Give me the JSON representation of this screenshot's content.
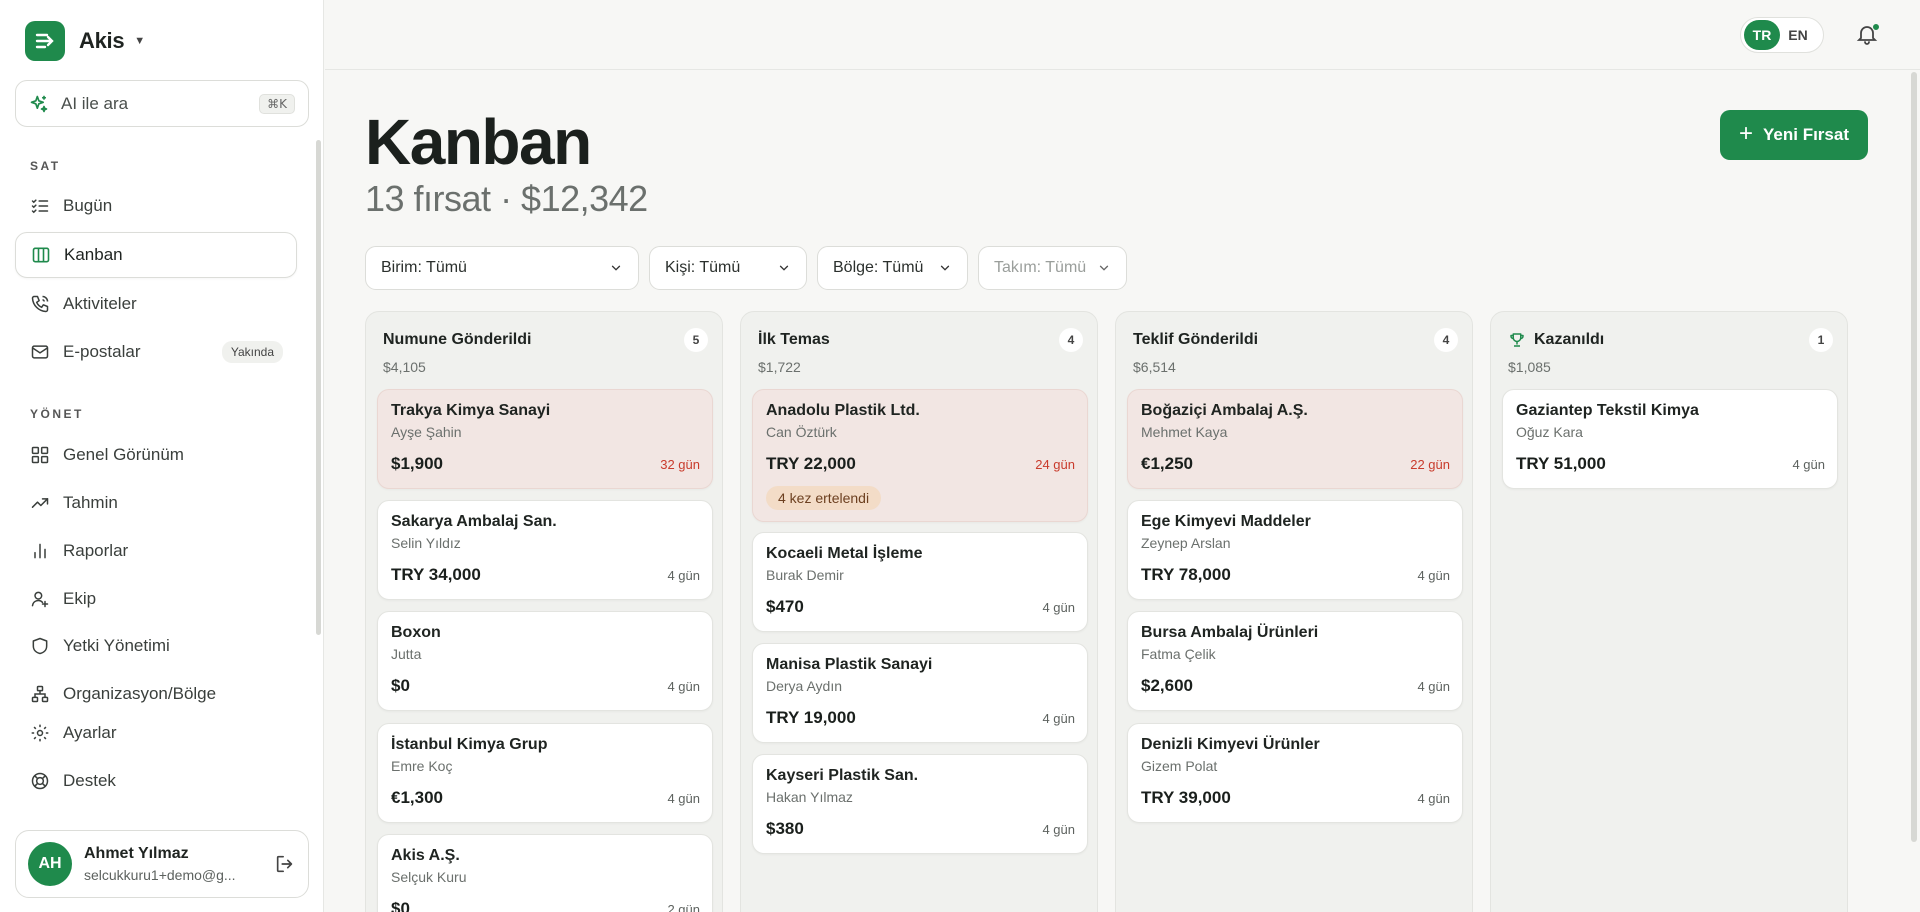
{
  "brand": {
    "name": "Akis"
  },
  "ai_search": {
    "label": "AI ile ara",
    "shortcut": "⌘K"
  },
  "sidebar": {
    "section_sell": "SAT",
    "section_manage": "YÖNET",
    "items": [
      {
        "label": "Bugün"
      },
      {
        "label": "Kanban"
      },
      {
        "label": "Aktiviteler"
      },
      {
        "label": "E-postalar",
        "badge": "Yakında"
      },
      {
        "label": "Genel Görünüm"
      },
      {
        "label": "Tahmin"
      },
      {
        "label": "Raporlar"
      },
      {
        "label": "Ekip"
      },
      {
        "label": "Yetki Yönetimi"
      },
      {
        "label": "Organizasyon/Bölge"
      },
      {
        "label": "Ayarlar"
      },
      {
        "label": "Destek"
      }
    ]
  },
  "user": {
    "initials": "AH",
    "name": "Ahmet Yılmaz",
    "email": "selcukkuru1+demo@g..."
  },
  "lang": {
    "tr": "TR",
    "en": "EN",
    "selected": "TR"
  },
  "header": {
    "title": "Kanban",
    "subtitle": "13 fırsat · $12,342",
    "new_button": "Yeni Fırsat"
  },
  "filters": [
    {
      "label": "Birim: Tümü"
    },
    {
      "label": "Kişi: Tümü"
    },
    {
      "label": "Bölge: Tümü"
    },
    {
      "label": "Takım: Tümü"
    }
  ],
  "columns": [
    {
      "title": "Numune Gönderildi",
      "count": "5",
      "total": "$4,105",
      "cards": [
        {
          "title": "Trakya Kimya Sanayi",
          "person": "Ayşe Şahin",
          "amount": "$1,900",
          "days": "32 gün"
        },
        {
          "title": "Sakarya Ambalaj San.",
          "person": "Selin Yıldız",
          "amount": "TRY 34,000",
          "days": "4 gün"
        },
        {
          "title": "Boxon",
          "person": "Jutta",
          "amount": "$0",
          "days": "4 gün"
        },
        {
          "title": "İstanbul Kimya Grup",
          "person": "Emre Koç",
          "amount": "€1,300",
          "days": "4 gün"
        },
        {
          "title": "Akis A.Ş.",
          "person": "Selçuk Kuru",
          "amount": "$0",
          "days": "2 gün"
        }
      ]
    },
    {
      "title": "İlk Temas",
      "count": "4",
      "total": "$1,722",
      "cards": [
        {
          "title": "Anadolu Plastik Ltd.",
          "person": "Can Öztürk",
          "amount": "TRY 22,000",
          "days": "24 gün",
          "postponed": "4 kez ertelendi"
        },
        {
          "title": "Kocaeli Metal İşleme",
          "person": "Burak Demir",
          "amount": "$470",
          "days": "4 gün"
        },
        {
          "title": "Manisa Plastik Sanayi",
          "person": "Derya Aydın",
          "amount": "TRY 19,000",
          "days": "4 gün"
        },
        {
          "title": "Kayseri Plastik San.",
          "person": "Hakan Yılmaz",
          "amount": "$380",
          "days": "4 gün"
        }
      ]
    },
    {
      "title": "Teklif Gönderildi",
      "count": "4",
      "total": "$6,514",
      "cards": [
        {
          "title": "Boğaziçi Ambalaj A.Ş.",
          "person": "Mehmet Kaya",
          "amount": "€1,250",
          "days": "22 gün"
        },
        {
          "title": "Ege Kimyevi Maddeler",
          "person": "Zeynep Arslan",
          "amount": "TRY 78,000",
          "days": "4 gün"
        },
        {
          "title": "Bursa Ambalaj Ürünleri",
          "person": "Fatma Çelik",
          "amount": "$2,600",
          "days": "4 gün"
        },
        {
          "title": "Denizli Kimyevi Ürünler",
          "person": "Gizem Polat",
          "amount": "TRY 39,000",
          "days": "4 gün"
        }
      ]
    },
    {
      "title": "Kazanıldı",
      "count": "1",
      "total": "$1,085",
      "icon": "trophy-icon",
      "cards": [
        {
          "title": "Gaziantep Tekstil Kimya",
          "person": "Oğuz Kara",
          "amount": "TRY 51,000",
          "days": "4 gün"
        }
      ]
    }
  ],
  "colors": {
    "accent": "#1f8a4c",
    "overdue": "#c93b2c",
    "overdue_bg": "#f2e6e3",
    "postpone_bg": "#f3dcc7"
  }
}
